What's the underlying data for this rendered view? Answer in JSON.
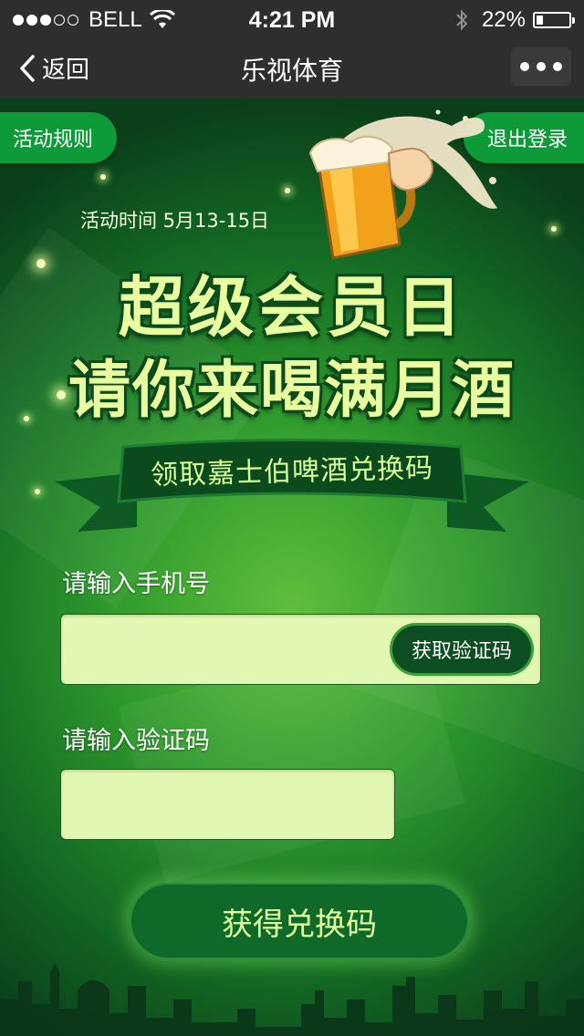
{
  "status_bar": {
    "carrier": "BELL",
    "time": "4:21 PM",
    "battery": "22%",
    "battery_level": 0.22,
    "signal_bars_filled": 3,
    "signal_bars_total": 5,
    "icons": [
      "wifi-icon",
      "bluetooth-icon",
      "battery-icon"
    ]
  },
  "nav": {
    "back_label": "返回",
    "title": "乐视体育",
    "more_icon": "more-dots-icon"
  },
  "promo": {
    "rules_button": "活动规则",
    "logout_button": "退出登录",
    "activity_time": "活动时间 5月13-15日",
    "headline_1": "超级会员日",
    "headline_2": "请你来喝满月酒",
    "ribbon_text": "领取嘉士伯啤酒兑换码",
    "illustration": "beer-mug-icon"
  },
  "form": {
    "phone_label": "请输入手机号",
    "phone_value": "",
    "get_code_button": "获取验证码",
    "code_label": "请输入验证码",
    "code_value": "",
    "submit_button": "获得兑换码"
  },
  "colors": {
    "accent_green": "#0f9a3a",
    "headline_yellow": "#e9ff9f",
    "input_bg": "#e2f7b1",
    "bar_bg": "#2e2e2e"
  }
}
